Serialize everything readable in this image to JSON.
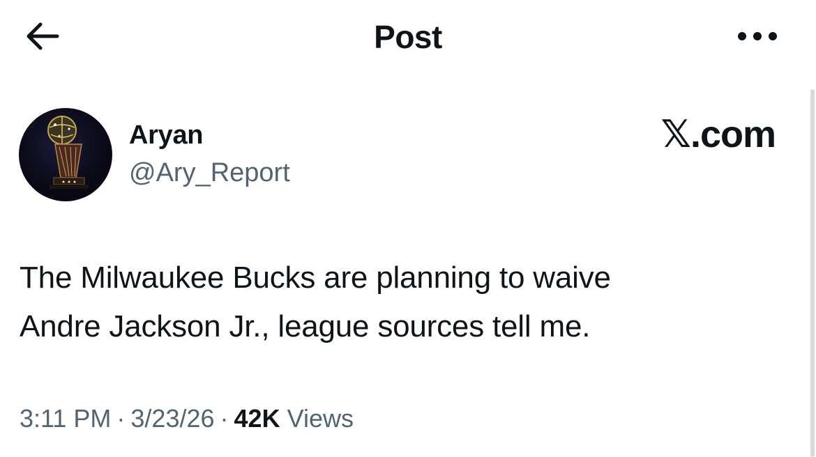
{
  "header": {
    "title": "Post",
    "back_icon": "arrow-left-icon",
    "more_icon": "more-horizontal-icon"
  },
  "author": {
    "name": "Aryan",
    "handle": "@Ary_Report",
    "avatar_icon": "trophy-icon"
  },
  "watermark": "𝕏.com",
  "tweet": {
    "lines": [
      "The Milwaukee Bucks are planning to waive",
      "Andre Jackson Jr., league sources tell me."
    ]
  },
  "meta": {
    "time": "3:11 PM",
    "separator": "·",
    "date": "3/23/26",
    "views_count": "42K",
    "views_label": "Views"
  },
  "colors": {
    "text": "#0f1419",
    "secondary": "#536471",
    "background": "#ffffff"
  }
}
